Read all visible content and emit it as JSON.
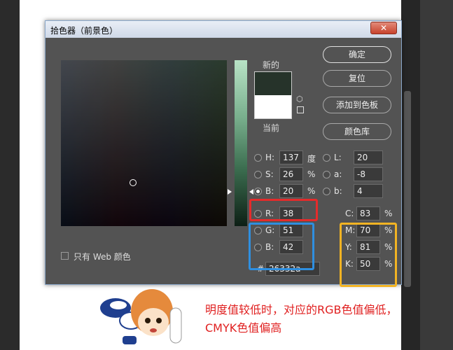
{
  "dialog": {
    "title": "拾色器（前景色）",
    "close_label": "✕"
  },
  "preview": {
    "new_label": "新的",
    "current_label": "当前",
    "new_color": "#26332a",
    "current_color": "#ffffff"
  },
  "buttons": {
    "ok": "确定",
    "reset": "复位",
    "add_swatch": "添加到色板",
    "color_library": "颜色库"
  },
  "hsb": {
    "h": {
      "label": "H:",
      "value": "137",
      "unit": "度"
    },
    "s": {
      "label": "S:",
      "value": "26",
      "unit": "%"
    },
    "b": {
      "label": "B:",
      "value": "20",
      "unit": "%"
    }
  },
  "rgb": {
    "r": {
      "label": "R:",
      "value": "38"
    },
    "g": {
      "label": "G:",
      "value": "51"
    },
    "b": {
      "label": "B:",
      "value": "42"
    }
  },
  "lab": {
    "l": {
      "label": "L:",
      "value": "20"
    },
    "a": {
      "label": "a:",
      "value": "-8"
    },
    "b": {
      "label": "b:",
      "value": "4"
    }
  },
  "cmyk": {
    "c": {
      "label": "C:",
      "value": "83",
      "unit": "%"
    },
    "m": {
      "label": "M:",
      "value": "70",
      "unit": "%"
    },
    "y": {
      "label": "Y:",
      "value": "81",
      "unit": "%"
    },
    "k": {
      "label": "K:",
      "value": "50",
      "unit": "%"
    }
  },
  "hex": {
    "label": "#",
    "value": "26332a"
  },
  "web_only_label": "只有 Web 颜色",
  "annotation": "明度值较低时，对应的RGB色值偏低，CMYK色值偏高",
  "colors": {
    "highlight_red": "#e52b2b",
    "highlight_blue": "#2f8fe0",
    "highlight_yellow": "#f2b323",
    "annotation_text": "#e02020"
  }
}
